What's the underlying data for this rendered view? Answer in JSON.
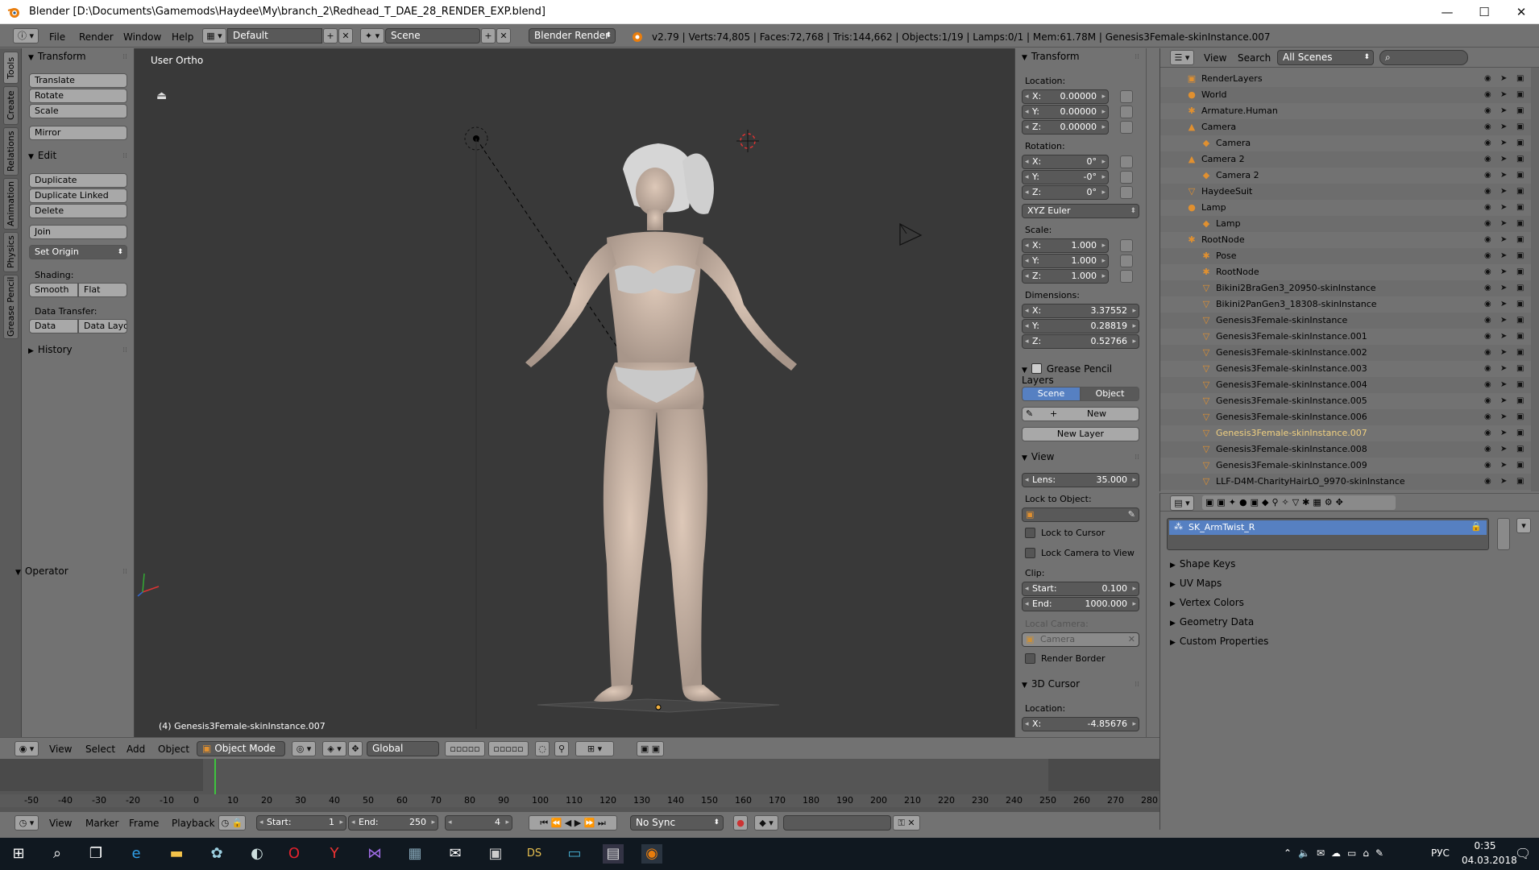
{
  "window": {
    "title": "Blender [D:\\Documents\\Gamemods\\Haydee\\My\\branch_2\\Redhead_T_DAE_28_RENDER_EXP.blend]",
    "minimize": "—",
    "maximize": "☐",
    "close": "✕"
  },
  "infobar": {
    "menus": [
      "File",
      "Render",
      "Window",
      "Help"
    ],
    "layout": "Default",
    "scene": "Scene",
    "engine": "Blender Render",
    "stats": "v2.79 | Verts:74,805 | Faces:72,768 | Tris:144,662 | Objects:1/19 | Lamps:0/1 | Mem:61.78M | Genesis3Female-skinInstance.007"
  },
  "shelf_tabs": [
    "Tools",
    "Create",
    "Relations",
    "Animation",
    "Physics",
    "Grease Pencil"
  ],
  "toolshelf": {
    "transform_header": "Transform",
    "transform_buttons": [
      "Translate",
      "Rotate",
      "Scale"
    ],
    "mirror": "Mirror",
    "edit_header": "Edit",
    "edit_buttons": [
      "Duplicate",
      "Duplicate Linked",
      "Delete"
    ],
    "join": "Join",
    "set_origin": "Set Origin",
    "shading_label": "Shading:",
    "smooth": "Smooth",
    "flat": "Flat",
    "data_transfer_label": "Data Transfer:",
    "data": "Data",
    "data_layo": "Data Layo",
    "history": "History",
    "operator": "Operator"
  },
  "viewport": {
    "view_label": "User Ortho",
    "object_label": "(4) Genesis3Female-skinInstance.007"
  },
  "npanel": {
    "transform_header": "Transform",
    "location_label": "Location:",
    "location": [
      {
        "k": "X:",
        "v": "0.00000"
      },
      {
        "k": "Y:",
        "v": "0.00000"
      },
      {
        "k": "Z:",
        "v": "0.00000"
      }
    ],
    "rotation_label": "Rotation:",
    "rotation": [
      {
        "k": "X:",
        "v": "0°"
      },
      {
        "k": "Y:",
        "v": "-0°"
      },
      {
        "k": "Z:",
        "v": "0°"
      }
    ],
    "rotation_mode": "XYZ Euler",
    "scale_label": "Scale:",
    "scale": [
      {
        "k": "X:",
        "v": "1.000"
      },
      {
        "k": "Y:",
        "v": "1.000"
      },
      {
        "k": "Z:",
        "v": "1.000"
      }
    ],
    "dimensions_label": "Dimensions:",
    "dimensions": [
      {
        "k": "X:",
        "v": "3.37552"
      },
      {
        "k": "Y:",
        "v": "0.28819"
      },
      {
        "k": "Z:",
        "v": "0.52766"
      }
    ],
    "gp_header": "Grease Pencil Layers",
    "gp_scene": "Scene",
    "gp_object": "Object",
    "gp_new": "New",
    "gp_new_layer": "New Layer",
    "view_header": "View",
    "lens_label": "Lens:",
    "lens_value": "35.000",
    "lock_to_object": "Lock to Object:",
    "lock_to_cursor": "Lock to Cursor",
    "lock_camera": "Lock Camera to View",
    "clip_label": "Clip:",
    "clip_start_k": "Start:",
    "clip_start_v": "0.100",
    "clip_end_k": "End:",
    "clip_end_v": "1000.000",
    "local_camera": "Local Camera:",
    "camera_field": "Camera",
    "render_border": "Render Border",
    "cursor_header": "3D Cursor",
    "cursor_location": "Location:",
    "cursor_x_k": "X:",
    "cursor_x_v": "-4.85676"
  },
  "outliner": {
    "view": "View",
    "search": "Search",
    "filter": "All Scenes",
    "rows": [
      {
        "name": "RenderLayers",
        "indent": 1,
        "icon": "▣"
      },
      {
        "name": "World",
        "indent": 1,
        "icon": "●"
      },
      {
        "name": "Armature.Human",
        "indent": 1,
        "icon": "✱"
      },
      {
        "name": "Camera",
        "indent": 1,
        "icon": "▲"
      },
      {
        "name": "Camera",
        "indent": 2,
        "icon": "◆"
      },
      {
        "name": "Camera 2",
        "indent": 1,
        "icon": "▲"
      },
      {
        "name": "Camera 2",
        "indent": 2,
        "icon": "◆"
      },
      {
        "name": "HaydeeSuit",
        "indent": 1,
        "icon": "▽"
      },
      {
        "name": "Lamp",
        "indent": 1,
        "icon": "●"
      },
      {
        "name": "Lamp",
        "indent": 2,
        "icon": "◆"
      },
      {
        "name": "RootNode",
        "indent": 1,
        "icon": "✱"
      },
      {
        "name": "Pose",
        "indent": 2,
        "icon": "✱"
      },
      {
        "name": "RootNode",
        "indent": 2,
        "icon": "✱"
      },
      {
        "name": "Bikini2BraGen3_20950-skinInstance",
        "indent": 2,
        "icon": "▽"
      },
      {
        "name": "Bikini2PanGen3_18308-skinInstance",
        "indent": 2,
        "icon": "▽"
      },
      {
        "name": "Genesis3Female-skinInstance",
        "indent": 2,
        "icon": "▽"
      },
      {
        "name": "Genesis3Female-skinInstance.001",
        "indent": 2,
        "icon": "▽"
      },
      {
        "name": "Genesis3Female-skinInstance.002",
        "indent": 2,
        "icon": "▽"
      },
      {
        "name": "Genesis3Female-skinInstance.003",
        "indent": 2,
        "icon": "▽"
      },
      {
        "name": "Genesis3Female-skinInstance.004",
        "indent": 2,
        "icon": "▽"
      },
      {
        "name": "Genesis3Female-skinInstance.005",
        "indent": 2,
        "icon": "▽"
      },
      {
        "name": "Genesis3Female-skinInstance.006",
        "indent": 2,
        "icon": "▽"
      },
      {
        "name": "Genesis3Female-skinInstance.007",
        "indent": 2,
        "icon": "▽",
        "selected": true
      },
      {
        "name": "Genesis3Female-skinInstance.008",
        "indent": 2,
        "icon": "▽"
      },
      {
        "name": "Genesis3Female-skinInstance.009",
        "indent": 2,
        "icon": "▽"
      },
      {
        "name": "LLF-D4M-CharityHairLO_9970-skinInstance",
        "indent": 2,
        "icon": "▽"
      }
    ]
  },
  "props": {
    "vertex_group": "SK_ArmTwist_R",
    "sections": [
      "Shape Keys",
      "UV Maps",
      "Vertex Colors",
      "Geometry Data",
      "Custom Properties"
    ]
  },
  "vpheader": {
    "menus": [
      "View",
      "Select",
      "Add",
      "Object"
    ],
    "mode": "Object Mode",
    "orientation": "Global"
  },
  "timeline": {
    "ticks": [
      "-50",
      "-40",
      "-30",
      "-20",
      "-10",
      "0",
      "10",
      "20",
      "30",
      "40",
      "50",
      "60",
      "70",
      "80",
      "90",
      "100",
      "110",
      "120",
      "130",
      "140",
      "150",
      "160",
      "170",
      "180",
      "190",
      "200",
      "210",
      "220",
      "230",
      "240",
      "250",
      "260",
      "270",
      "280"
    ],
    "menus": [
      "View",
      "Marker",
      "Frame",
      "Playback"
    ],
    "start_k": "Start:",
    "start_v": "1",
    "end_k": "End:",
    "end_v": "250",
    "current": "4",
    "sync": "No Sync"
  },
  "taskbar": {
    "lang": "РУС",
    "time": "0:35",
    "date": "04.03.2018"
  },
  "colors": {
    "accent": "#5680c2",
    "selected_text": "#f0d080",
    "orange_icon": "#e09030"
  }
}
